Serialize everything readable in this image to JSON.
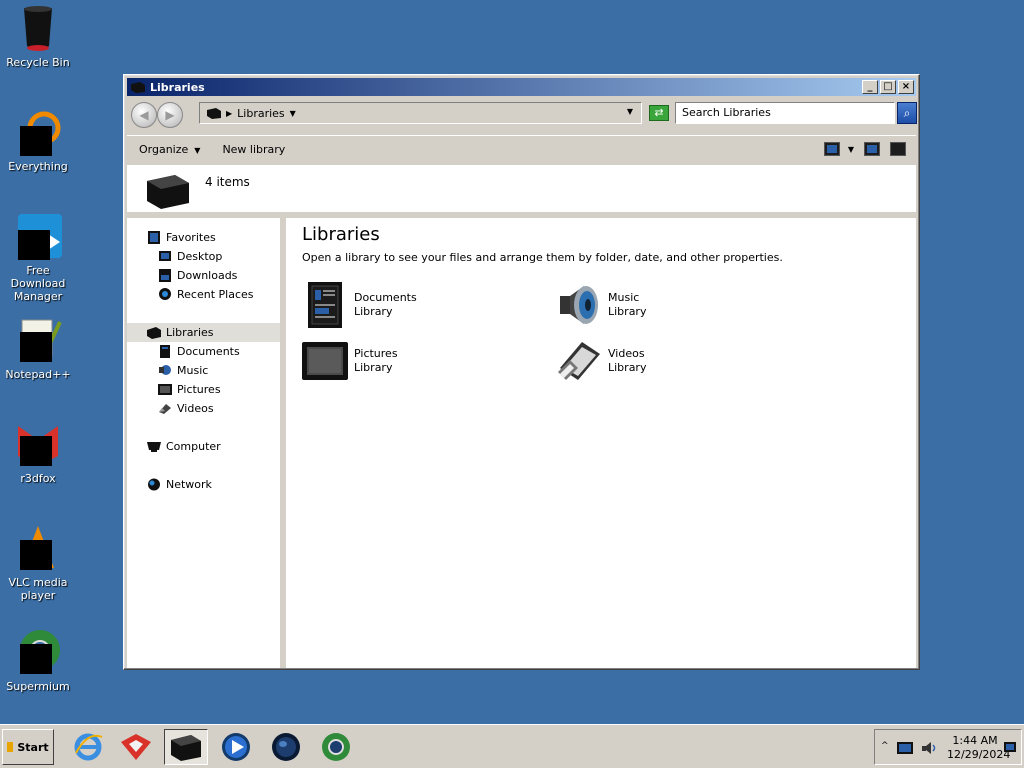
{
  "desktop": {
    "icons": [
      {
        "label": "Recycle Bin"
      },
      {
        "label": "Everything"
      },
      {
        "label": "Free Download Manager"
      },
      {
        "label": "Notepad++"
      },
      {
        "label": "r3dfox"
      },
      {
        "label": "VLC media player"
      },
      {
        "label": "Supermium"
      }
    ]
  },
  "window": {
    "title": "Libraries",
    "address": {
      "crumb": "Libraries"
    },
    "search": {
      "placeholder": "Search Libraries"
    },
    "toolbar": {
      "organize": "Organize",
      "new_library": "New library"
    },
    "info": {
      "count": "4 items"
    },
    "nav": {
      "favorites": "Favorites",
      "desktop": "Desktop",
      "downloads": "Downloads",
      "recent_places": "Recent Places",
      "libraries": "Libraries",
      "documents": "Documents",
      "music": "Music",
      "pictures": "Pictures",
      "videos": "Videos",
      "computer": "Computer",
      "network": "Network"
    },
    "content": {
      "title": "Libraries",
      "subtitle": "Open a library to see your files and arrange them by folder, date, and other properties.",
      "libraries": [
        {
          "name": "Documents",
          "type": "Library",
          "icon": "documents-library-icon"
        },
        {
          "name": "Music",
          "type": "Library",
          "icon": "music-library-icon"
        },
        {
          "name": "Pictures",
          "type": "Library",
          "icon": "pictures-library-icon"
        },
        {
          "name": "Videos",
          "type": "Library",
          "icon": "videos-library-icon"
        }
      ]
    }
  },
  "taskbar": {
    "start": "Start",
    "clock": {
      "time": "1:44 AM",
      "date": "12/29/2024"
    }
  },
  "colors": {
    "desktop": "#3a6ea5",
    "titlebar_start": "#0a246a",
    "titlebar_end": "#a6caf0",
    "selection": "#e0ded8"
  }
}
